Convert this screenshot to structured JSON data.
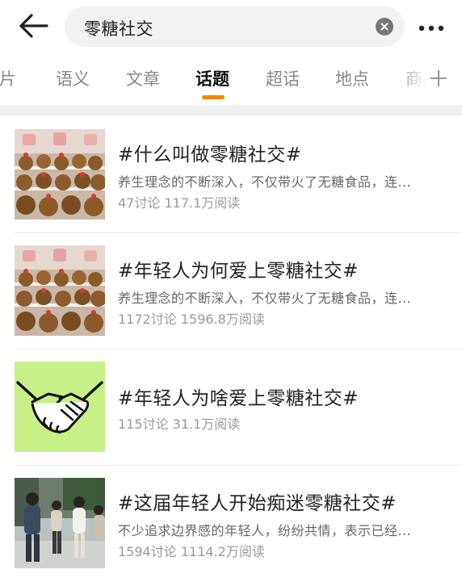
{
  "search": {
    "query": "零糖社交"
  },
  "tabs": [
    {
      "label": "图片"
    },
    {
      "label": "语义"
    },
    {
      "label": "文章"
    },
    {
      "label": "话题"
    },
    {
      "label": "超话"
    },
    {
      "label": "地点"
    },
    {
      "label": "商品"
    }
  ],
  "active_tab": "话题",
  "colors": {
    "accent": "#ff8200",
    "thumb_green": "#c7f089"
  },
  "topics": [
    {
      "title": "#什么叫做零糖社交#",
      "desc": "养生理念的不断深入，不仅带火了无糖食品，连...",
      "discussions": "47讨论",
      "reads": "117.1万阅读",
      "thumb": "plush-toys-image"
    },
    {
      "title": "#年轻人为何爱上零糖社交#",
      "desc": "养生理念的不断深入，不仅带火了无糖食品，连...",
      "discussions": "1172讨论",
      "reads": "1596.8万阅读",
      "thumb": "plush-toys-image"
    },
    {
      "title": "#年轻人为啥爱上零糖社交#",
      "desc": "",
      "discussions": "115讨论",
      "reads": "31.1万阅读",
      "thumb": "handshake-icon"
    },
    {
      "title": "#这届年轻人开始痴迷零糖社交#",
      "desc": "不少追求边界感的年轻人，纷纷共情，表示已经...",
      "discussions": "1594讨论",
      "reads": "1114.2万阅读",
      "thumb": "people-photo"
    }
  ]
}
